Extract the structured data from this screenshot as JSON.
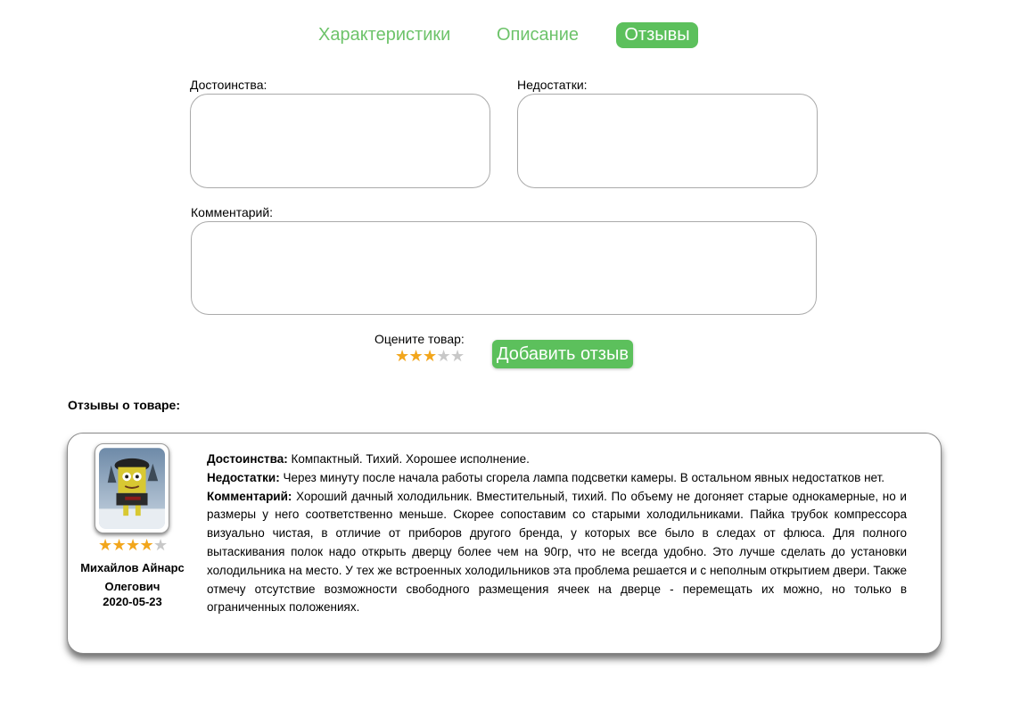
{
  "tabs": [
    {
      "label": "Характеристики"
    },
    {
      "label": "Описание"
    },
    {
      "label": "Отзывы",
      "active": true
    }
  ],
  "form": {
    "pros_label": "Достоинства:",
    "pros_value": "",
    "cons_label": "Недостатки:",
    "cons_value": "",
    "comment_label": "Комментарий:",
    "comment_value": "",
    "rate_label": "Оцените товар:",
    "rating": 3,
    "rating_max": 5,
    "submit_label": "Добавить отзыв"
  },
  "reviews_heading": "Отзывы о товаре:",
  "reviews": [
    {
      "author": "Михайлов Айнарс Олегович",
      "date": "2020-05-23",
      "rating": 4,
      "rating_max": 5,
      "pros_label": "Достоинства:",
      "pros": "Компактный. Тихий. Хорошее исполнение.",
      "cons_label": "Недостатки:",
      "cons": "Через минуту после начала работы сгорела лампа подсветки камеры. В остальном явных недостатков нет.",
      "comment_label": "Комментарий:",
      "comment": "Хороший дачный холодильник. Вместительный, тихий. По объему не догоняет старые однокамерные, но и размеры у него соответственно меньше. Скорее сопоставим со старыми холодильниками. Пайка трубок компрессора визуально чистая, в отличие от приборов другого бренда, у которых все было в следах от флюса. Для полного вытаскивания полок надо открыть дверцу более чем на 90гр, что не всегда удобно. Это лучше сделать до установки холодильника на место. У тех же встроенных холодильников эта проблема решается и с неполным открытием двери. Также отмечу отсутствие возможности свободного размещения ячеек на дверце - перемещать их можно, но только в ограниченных положениях."
    }
  ],
  "colors": {
    "accent": "#5cc05c",
    "tab_text": "#6dc36a",
    "star_on": "#f2a61c",
    "star_off": "#c8c8c8"
  }
}
